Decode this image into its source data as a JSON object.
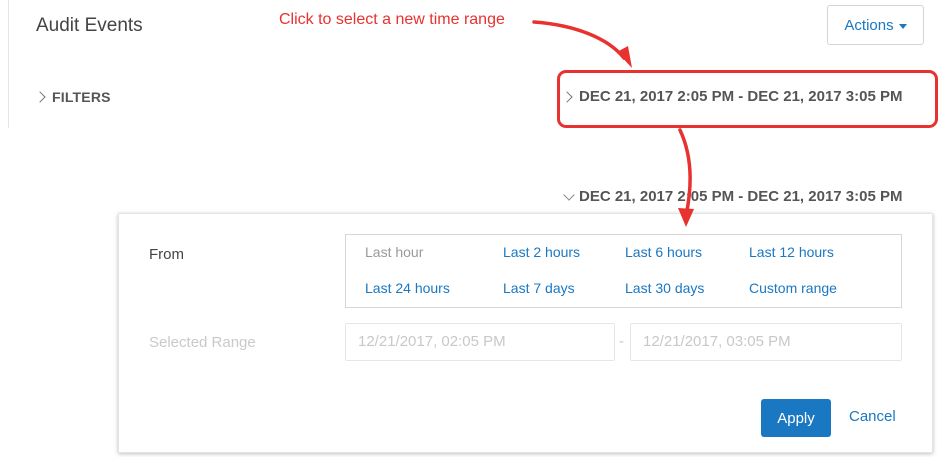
{
  "header": {
    "title": "Audit Events",
    "actions_label": "Actions"
  },
  "annotation": {
    "text": "Click to select a new time range",
    "color": "#e8322f"
  },
  "filters": {
    "label": "FILTERS"
  },
  "time_range": {
    "label": "DEC 21, 2017 2:05 PM - DEC 21, 2017 3:05 PM"
  },
  "picker": {
    "from_label": "From",
    "presets": [
      {
        "label": "Last hour",
        "selected": true
      },
      {
        "label": "Last 2 hours",
        "selected": false
      },
      {
        "label": "Last 6 hours",
        "selected": false
      },
      {
        "label": "Last 12 hours",
        "selected": false
      },
      {
        "label": "Last 24 hours",
        "selected": false
      },
      {
        "label": "Last 7 days",
        "selected": false
      },
      {
        "label": "Last 30 days",
        "selected": false
      },
      {
        "label": "Custom range",
        "selected": false
      }
    ],
    "selected_range_label": "Selected Range",
    "start_value": "12/21/2017, 02:05 PM",
    "separator": "-",
    "end_value": "12/21/2017, 03:05 PM",
    "apply_label": "Apply",
    "cancel_label": "Cancel"
  },
  "colors": {
    "link_blue": "#1a78c2",
    "annotation_red": "#e8322f"
  }
}
